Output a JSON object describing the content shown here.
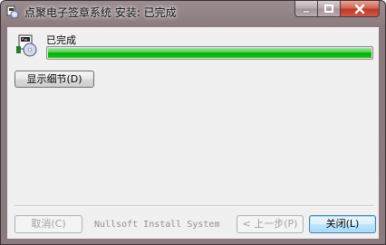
{
  "window": {
    "title": "点聚电子签章系统 安装: 已完成",
    "controls": {
      "minimize_icon": "minimize-icon",
      "maximize_icon": "maximize-icon",
      "close_icon": "close-icon"
    }
  },
  "status": {
    "text": "已完成",
    "progress_percent": 100
  },
  "buttons": {
    "details": "显示细节(D)",
    "cancel": "取消(C)",
    "back": "< 上一步(P)",
    "close": "关闭(L)"
  },
  "branding": "Nullsoft Install System",
  "colors": {
    "progress": "#06b006",
    "close_caption": "#c0372a"
  }
}
